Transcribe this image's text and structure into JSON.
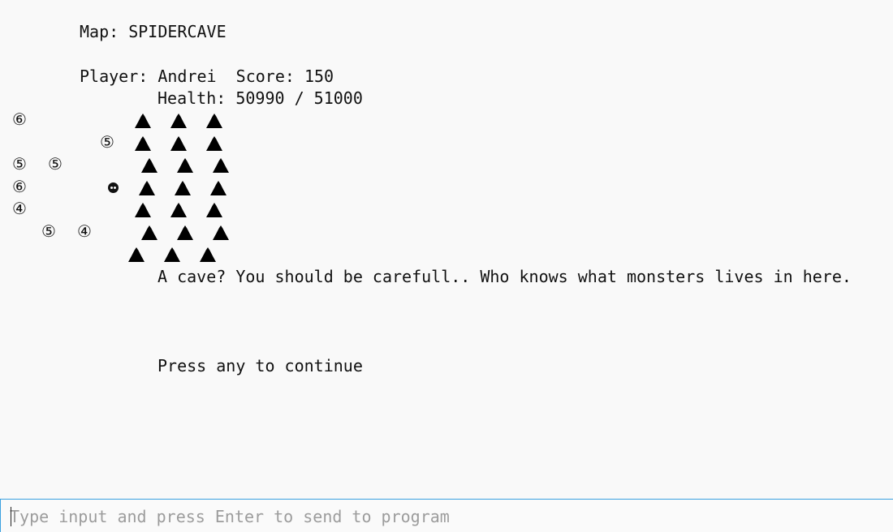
{
  "hud": {
    "map_line": "Map: SPIDERCAVE",
    "player_line": "Player: Andrei  Score: 150",
    "health_line": "Health: 50990 / 51000"
  },
  "map": {
    "trees": "▲",
    "monsters": [
      "⑥",
      "⑤",
      "⑤",
      "⑤",
      "⑥",
      "④",
      "⑤",
      "④"
    ]
  },
  "messages": {
    "description": "A cave? You should be carefull.. Who knows what monsters lives in here.",
    "prompt": "Press any to continue"
  },
  "input": {
    "placeholder": "Type input and press Enter to send to program",
    "value": ""
  },
  "colors": {
    "background": "#f9f9f9",
    "text": "#111111",
    "input_border": "#3aa1e0",
    "placeholder": "#9c9c9c"
  }
}
